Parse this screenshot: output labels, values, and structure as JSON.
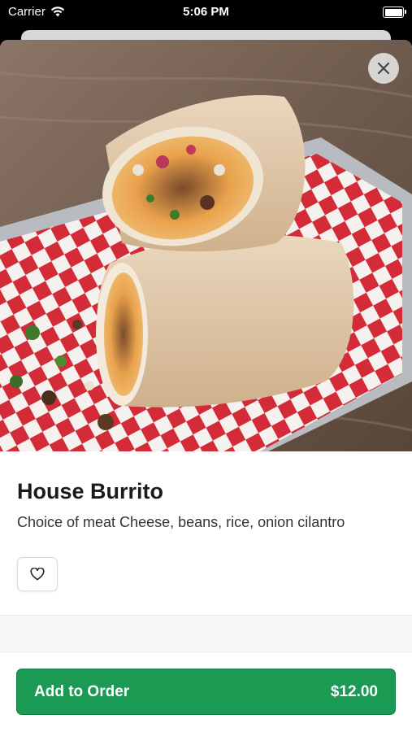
{
  "status_bar": {
    "carrier": "Carrier",
    "time": "5:06 PM",
    "battery_level": 1.0
  },
  "item": {
    "name": "House Burrito",
    "description": "Choice of meat Cheese, beans, rice, onion cilantro",
    "image_subject": "burrito cut in half on a red checkered paper-lined metal tray"
  },
  "actions": {
    "close_icon": "close-icon",
    "favorite_icon": "heart-icon",
    "add_to_order_label": "Add to Order",
    "price": "$12.00"
  },
  "colors": {
    "accent_green": "#1a9a53",
    "checker_red": "#d42b38"
  }
}
